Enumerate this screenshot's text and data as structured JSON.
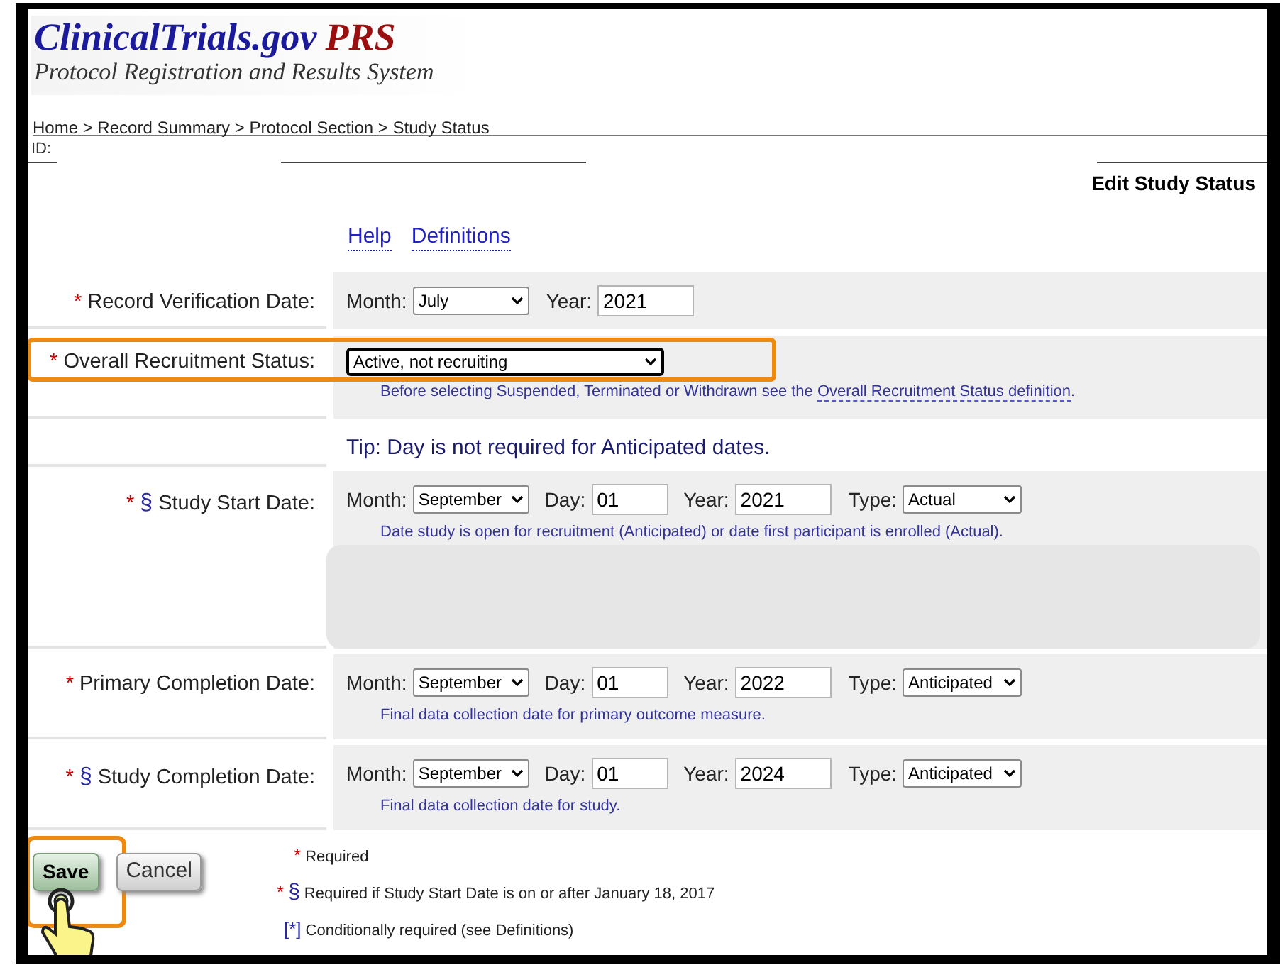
{
  "header": {
    "logo_title": "ClinicalTrials.gov",
    "logo_accent": "PRS",
    "logo_subtitle": "Protocol Registration and Results System"
  },
  "breadcrumb": "Home > Record Summary > Protocol Section > Study Status",
  "id_label": "ID:",
  "page_heading": "Edit Study Status",
  "help_links": [
    "Help",
    "Definitions"
  ],
  "fields": [
    {
      "kind": "month_year",
      "required_mark": "*",
      "label": "Record Verification Date:",
      "month_label": "Month:",
      "month": "July",
      "year_label": "Year:",
      "year": "2021",
      "highlighted": false
    },
    {
      "kind": "select",
      "required_mark": "*",
      "label": "Overall Recruitment Status:",
      "value": "Active, not recruiting",
      "hint": "Before selecting Suspended, Terminated or Withdrawn see the",
      "hint_link": "Overall Recruitment Status definition",
      "hint_end": ".",
      "highlighted": true
    },
    {
      "kind": "tip",
      "text": "Tip: Day is not required for Anticipated dates."
    },
    {
      "kind": "full_date",
      "required_mark": "*",
      "section_mark": "§",
      "label": "Study Start Date:",
      "month_label": "Month:",
      "month": "September",
      "day_label": "Day:",
      "day": "01",
      "year_label": "Year:",
      "year": "2021",
      "type_label": "Type:",
      "type": "Actual",
      "hint": "Date study is open for recruitment (Anticipated) or date first participant is enrolled (Actual).",
      "redacted": true
    },
    {
      "kind": "full_date",
      "required_mark": "*",
      "label": "Primary Completion Date:",
      "month_label": "Month:",
      "month": "September",
      "day_label": "Day:",
      "day": "01",
      "year_label": "Year:",
      "year": "2022",
      "type_label": "Type:",
      "type": "Anticipated",
      "hint": "Final data collection date for primary outcome measure.",
      "redacted": false
    },
    {
      "kind": "full_date",
      "required_mark": "*",
      "section_mark": "§",
      "label": "Study Completion Date:",
      "month_label": "Month:",
      "month": "September",
      "day_label": "Day:",
      "day": "01",
      "year_label": "Year:",
      "year": "2024",
      "type_label": "Type:",
      "type": "Anticipated",
      "hint": "Final data collection date for study.",
      "redacted": false
    }
  ],
  "buttons": [
    {
      "label": "Save",
      "kind": "primary",
      "highlighted": true,
      "pointer": true
    },
    {
      "label": "Cancel",
      "kind": "secondary",
      "highlighted": false,
      "pointer": false
    }
  ],
  "legend": [
    {
      "marks": [
        {
          "text": "*",
          "kind": "required"
        }
      ],
      "text": "Required"
    },
    {
      "marks": [
        {
          "text": "*",
          "kind": "required"
        },
        {
          "text": "§",
          "kind": "section"
        }
      ],
      "text": "Required if Study Start Date is on or after January 18, 2017"
    },
    {
      "marks": [
        {
          "text": "[*]",
          "kind": "conditional"
        }
      ],
      "text": "Conditionally required (see Definitions)"
    }
  ]
}
